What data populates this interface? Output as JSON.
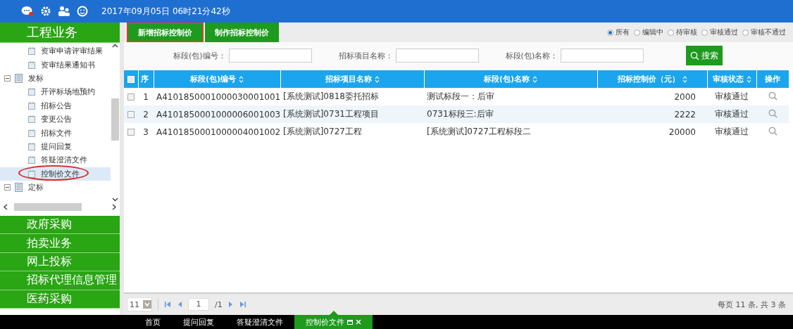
{
  "top_bar": {
    "datetime": "2017年09月05日 06时21分42秒"
  },
  "sidebar": {
    "header": "工程业务",
    "tree": [
      {
        "kind": "doc",
        "label": "资审申请评审结果",
        "selected": false,
        "circled": false
      },
      {
        "kind": "doc",
        "label": "资审结果通知书",
        "selected": false,
        "circled": false
      },
      {
        "kind": "folder",
        "label": "发标",
        "expanded": true,
        "children": [
          {
            "kind": "doc",
            "label": "开评标场地预约",
            "selected": false,
            "circled": false
          },
          {
            "kind": "doc",
            "label": "招标公告",
            "selected": false,
            "circled": false
          },
          {
            "kind": "doc",
            "label": "变更公告",
            "selected": false,
            "circled": false
          },
          {
            "kind": "doc",
            "label": "招标文件",
            "selected": false,
            "circled": false
          },
          {
            "kind": "doc",
            "label": "提问回复",
            "selected": false,
            "circled": false
          },
          {
            "kind": "doc",
            "label": "答疑澄清文件",
            "selected": false,
            "circled": false
          },
          {
            "kind": "doc",
            "label": "控制价文件",
            "selected": true,
            "circled": true
          }
        ]
      },
      {
        "kind": "folder",
        "label": "定标",
        "expanded": true
      }
    ],
    "modules": [
      "政府采购",
      "拍卖业务",
      "网上投标",
      "招标代理信息管理",
      "医药采购"
    ]
  },
  "toolbar": {
    "buttons": [
      {
        "label": "新增招标控制价",
        "highlighted": true
      },
      {
        "label": "制作招标控制价",
        "highlighted": false
      }
    ],
    "filters": [
      {
        "label": "所有",
        "selected": true
      },
      {
        "label": "编辑中",
        "selected": false
      },
      {
        "label": "待审核",
        "selected": false
      },
      {
        "label": "审核通过",
        "selected": false
      },
      {
        "label": "审核不通过",
        "selected": false
      }
    ]
  },
  "search": {
    "fields": [
      {
        "label": "标段(包)编号："
      },
      {
        "label": "招标项目名称："
      },
      {
        "label": "标段(包)名称："
      }
    ],
    "button": "搜索"
  },
  "table": {
    "all_checked": false,
    "columns": [
      {
        "label": "序",
        "sortable": false
      },
      {
        "label": "标段(包)编号",
        "sortable": true
      },
      {
        "label": "招标项目名称",
        "sortable": true
      },
      {
        "label": "标段(包)名称",
        "sortable": true
      },
      {
        "label": "招标控制价（元）",
        "sortable": true
      },
      {
        "label": "审核状态",
        "sortable": true
      },
      {
        "label": "操作",
        "sortable": false
      }
    ],
    "rows": [
      {
        "checked": false,
        "cells": [
          "1",
          "A4101850001000030001001",
          "[系统测试]0818委托招标",
          "测试标段一：后审",
          "2000",
          "审核通过"
        ]
      },
      {
        "checked": false,
        "cells": [
          "2",
          "A4101850001000006001003",
          "[系统测试]0731工程项目",
          "0731标段三:后审",
          "2222",
          "审核通过"
        ]
      },
      {
        "checked": false,
        "cells": [
          "3",
          "A4101850001000004001002",
          "[系统测试]0727工程",
          "[系统测试]0727工程标段二",
          "20000",
          "审核通过"
        ]
      }
    ]
  },
  "pager": {
    "page_size": "11",
    "page": "1",
    "total_pages": "/1",
    "summary": "每页 11 条, 共 3 条"
  },
  "taskbar": [
    {
      "label": "首页",
      "selected": false
    },
    {
      "label": "提问回复",
      "selected": false
    },
    {
      "label": "答疑澄清文件",
      "selected": false
    },
    {
      "label": "控制价文件",
      "selected": true
    }
  ]
}
